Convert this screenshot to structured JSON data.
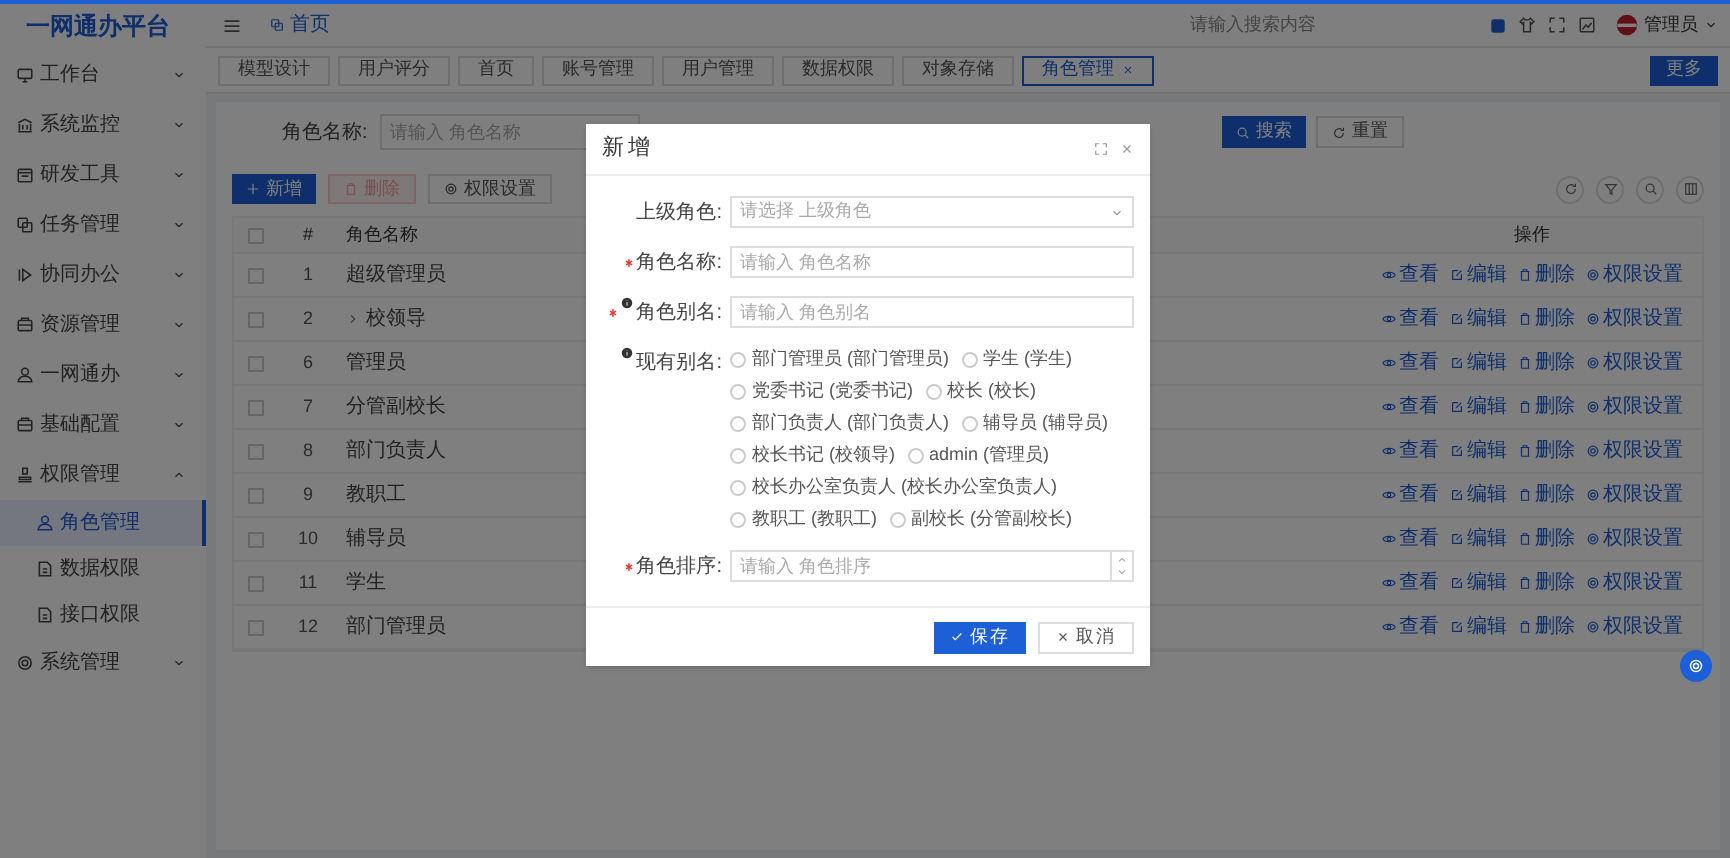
{
  "app": {
    "logo": "一网通办平台"
  },
  "header": {
    "breadcrumb": "首页",
    "search": {
      "placeholder": "请输入搜索内容"
    },
    "user": "管理员"
  },
  "sidebar": {
    "items": [
      {
        "label": "工作台",
        "expanded": false
      },
      {
        "label": "系统监控",
        "expanded": false
      },
      {
        "label": "研发工具",
        "expanded": false
      },
      {
        "label": "任务管理",
        "expanded": false
      },
      {
        "label": "协同办公",
        "expanded": false
      },
      {
        "label": "资源管理",
        "expanded": false
      },
      {
        "label": "一网通办",
        "expanded": false
      },
      {
        "label": "基础配置",
        "expanded": false
      },
      {
        "label": "权限管理",
        "expanded": true,
        "children": [
          {
            "label": "角色管理",
            "selected": true
          },
          {
            "label": "数据权限",
            "selected": false
          },
          {
            "label": "接口权限",
            "selected": false
          }
        ]
      },
      {
        "label": "系统管理",
        "expanded": false
      }
    ]
  },
  "tabs": [
    {
      "label": "模型设计",
      "selected": false
    },
    {
      "label": "用户评分",
      "selected": false
    },
    {
      "label": "首页",
      "selected": false
    },
    {
      "label": "账号管理",
      "selected": false
    },
    {
      "label": "用户管理",
      "selected": false
    },
    {
      "label": "数据权限",
      "selected": false
    },
    {
      "label": "对象存储",
      "selected": false
    },
    {
      "label": "角色管理",
      "selected": true
    }
  ],
  "more_button": "更多",
  "search_form": {
    "label": "角色名称:",
    "placeholder": "请输入 角色名称",
    "buttons": [
      {
        "label": "搜索",
        "kind": "primary"
      },
      {
        "label": "重置",
        "kind": "reset"
      }
    ]
  },
  "toolbar": [
    {
      "label": "新增",
      "kind": "add"
    },
    {
      "label": "删除",
      "kind": "delete"
    },
    {
      "label": "权限设置",
      "kind": "permission"
    }
  ],
  "table": {
    "select_all": {
      "checked": false
    },
    "columns": [
      "#",
      "角色名称",
      "操作"
    ],
    "rows": [
      {
        "no": "1",
        "name": "超级管理员",
        "checked": false,
        "expandable": false,
        "actions": [
          {
            "label": "查看",
            "kind": "view"
          },
          {
            "label": "编辑",
            "kind": "edit"
          },
          {
            "label": "删除",
            "kind": "delete"
          },
          {
            "label": "权限设置",
            "kind": "permission"
          }
        ]
      },
      {
        "no": "2",
        "name": "校领导",
        "checked": false,
        "expandable": true,
        "actions": [
          {
            "label": "查看",
            "kind": "view"
          },
          {
            "label": "编辑",
            "kind": "edit"
          },
          {
            "label": "删除",
            "kind": "delete"
          },
          {
            "label": "权限设置",
            "kind": "permission"
          }
        ]
      },
      {
        "no": "6",
        "name": "管理员",
        "checked": false,
        "expandable": false,
        "actions": [
          {
            "label": "查看",
            "kind": "view"
          },
          {
            "label": "编辑",
            "kind": "edit"
          },
          {
            "label": "删除",
            "kind": "delete"
          },
          {
            "label": "权限设置",
            "kind": "permission"
          }
        ]
      },
      {
        "no": "7",
        "name": "分管副校长",
        "checked": false,
        "expandable": false,
        "actions": [
          {
            "label": "查看",
            "kind": "view"
          },
          {
            "label": "编辑",
            "kind": "edit"
          },
          {
            "label": "删除",
            "kind": "delete"
          },
          {
            "label": "权限设置",
            "kind": "permission"
          }
        ]
      },
      {
        "no": "8",
        "name": "部门负责人",
        "checked": false,
        "expandable": false,
        "actions": [
          {
            "label": "查看",
            "kind": "view"
          },
          {
            "label": "编辑",
            "kind": "edit"
          },
          {
            "label": "删除",
            "kind": "delete"
          },
          {
            "label": "权限设置",
            "kind": "permission"
          }
        ]
      },
      {
        "no": "9",
        "name": "教职工",
        "checked": false,
        "expandable": false,
        "actions": [
          {
            "label": "查看",
            "kind": "view"
          },
          {
            "label": "编辑",
            "kind": "edit"
          },
          {
            "label": "删除",
            "kind": "delete"
          },
          {
            "label": "权限设置",
            "kind": "permission"
          }
        ]
      },
      {
        "no": "10",
        "name": "辅导员",
        "checked": false,
        "expandable": false,
        "actions": [
          {
            "label": "查看",
            "kind": "view"
          },
          {
            "label": "编辑",
            "kind": "edit"
          },
          {
            "label": "删除",
            "kind": "delete"
          },
          {
            "label": "权限设置",
            "kind": "permission"
          }
        ]
      },
      {
        "no": "11",
        "name": "学生",
        "checked": false,
        "expandable": false,
        "actions": [
          {
            "label": "查看",
            "kind": "view"
          },
          {
            "label": "编辑",
            "kind": "edit"
          },
          {
            "label": "删除",
            "kind": "delete"
          },
          {
            "label": "权限设置",
            "kind": "permission"
          }
        ]
      },
      {
        "no": "12",
        "name": "部门管理员",
        "checked": false,
        "expandable": false,
        "actions": [
          {
            "label": "查看",
            "kind": "view"
          },
          {
            "label": "编辑",
            "kind": "edit"
          },
          {
            "label": "删除",
            "kind": "delete"
          },
          {
            "label": "权限设置",
            "kind": "permission"
          }
        ]
      }
    ]
  },
  "dialog": {
    "title": "新增",
    "fields": [
      {
        "kind": "select",
        "label": "上级角色:",
        "required": false,
        "hint": false,
        "placeholder": "请选择 上级角色"
      },
      {
        "kind": "text",
        "label": "角色名称:",
        "required": true,
        "hint": false,
        "placeholder": "请输入 角色名称"
      },
      {
        "kind": "text",
        "label": "角色别名:",
        "required": true,
        "hint": true,
        "placeholder": "请输入 角色别名"
      },
      {
        "kind": "radios",
        "label": "现有别名:",
        "required": false,
        "hint": true,
        "options": [
          {
            "label": "部门管理员 (部门管理员)",
            "selected": false
          },
          {
            "label": "学生 (学生)",
            "selected": false
          },
          {
            "label": "党委书记 (党委书记)",
            "selected": false
          },
          {
            "label": "校长 (校长)",
            "selected": false
          },
          {
            "label": "部门负责人 (部门负责人)",
            "selected": false
          },
          {
            "label": "辅导员 (辅导员)",
            "selected": false
          },
          {
            "label": "校长书记 (校领导)",
            "selected": false
          },
          {
            "label": "admin (管理员)",
            "selected": false
          },
          {
            "label": "校长办公室负责人 (校长办公室负责人)",
            "selected": false
          },
          {
            "label": "教职工 (教职工)",
            "selected": false
          },
          {
            "label": "副校长 (分管副校长)",
            "selected": false
          }
        ]
      },
      {
        "kind": "number",
        "label": "角色排序:",
        "required": true,
        "hint": false,
        "placeholder": "请输入 角色排序"
      }
    ],
    "buttons": [
      {
        "label": "保存",
        "kind": "primary"
      },
      {
        "label": "取消",
        "kind": "default"
      }
    ]
  }
}
